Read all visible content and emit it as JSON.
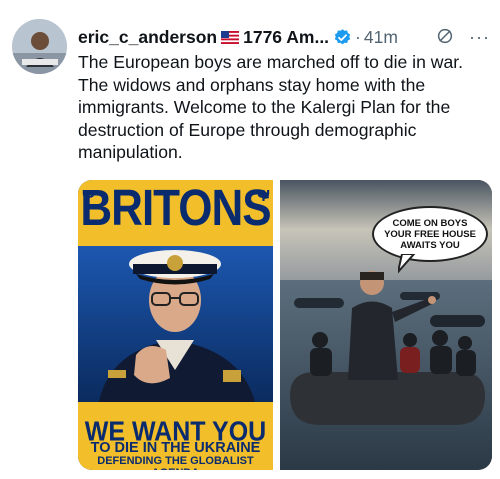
{
  "tweet": {
    "username": "eric_c_anderson",
    "flag_icon": "us-flag-icon",
    "display_name": "1776 Am...",
    "verified_icon": "verified-badge-icon",
    "separator": "·",
    "timestamp": "41m",
    "edit_icon": "edited-icon",
    "more_icon": "more-options-icon",
    "text": "The European boys are marched off to die in war. The widows and orphans stay home with the immigrants. Welcome to the Kalergi Plan for the destruction of Europe through demographic manipulation."
  },
  "media": {
    "poster": {
      "headline": "BRITONS",
      "line1": "WE WANT YOU",
      "line2": "TO DIE IN THE UKRAINE",
      "line3": "DEFENDING THE GLOBALIST AGENDA"
    },
    "boat_image": {
      "speech_bubble": [
        "COME ON BOYS",
        "YOUR FREE HOUSE",
        "AWAITS YOU"
      ]
    }
  },
  "colors": {
    "accent_blue": "#1d9bf0",
    "poster_yellow": "#f2bf2a",
    "poster_navy": "#0a2b6e"
  }
}
